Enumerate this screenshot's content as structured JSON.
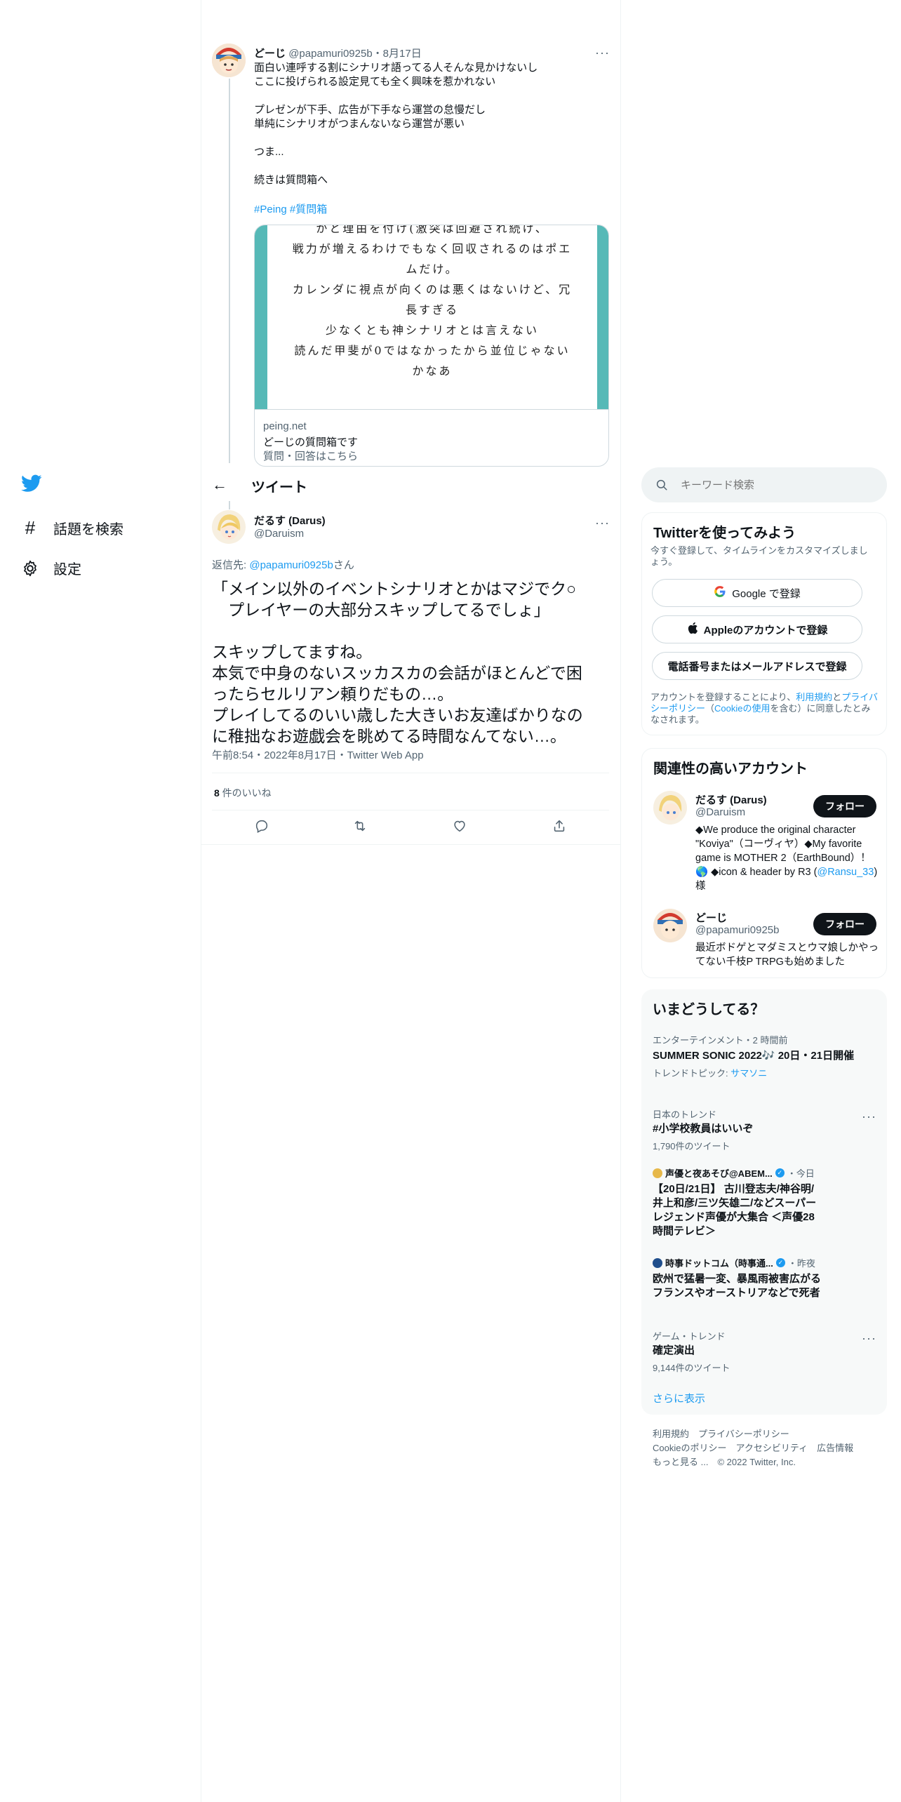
{
  "previous_tweet": {
    "author_name": "どーじ",
    "author_handle": "@papamuri0925b",
    "date": "・8月17日",
    "more": "···",
    "text": "面白い連呼する割にシナリオ語ってる人そんな見かけないし\nここに投げられる設定見ても全く興味を惹かれない\n\nプレゼンが下手、広告が下手なら運営の怠慢だし\n単純にシナリオがつまんないなら運営が悪い\n\nつま...\n\n続きは質問箱へ",
    "hashtags": "#Peing #質問箱",
    "card_image_text": "かと理由を付け(激突は回避され続け、\n戦力が増えるわけでもなく回収されるのはポエ\nムだけ。\nカレンダに視点が向くのは悪くはないけど、冗\n長すぎる\n少なくとも神シナリオとは言えない\n読んだ甲斐が0ではなかったから並位じゃない\nかなあ",
    "card_domain": "peing.net",
    "card_title": "どーじの質問箱です",
    "card_desc": "質問・回答はこちら"
  },
  "nav": {
    "explore_label": "話題を検索",
    "settings_label": "設定"
  },
  "header": {
    "back_arrow": "←",
    "title": "ツイート"
  },
  "main_tweet": {
    "author_name": "だるす (Darus)",
    "author_handle": "@Daruism",
    "more": "···",
    "reply_prefix": "返信先: ",
    "reply_handle": "@papamuri0925b",
    "reply_suffix": "さん",
    "text": "「メイン以外のイベントシナリオとかはマジでク○\n　プレイヤーの大部分スキップしてるでしょ」\n\nスキップしてますね。\n本気で中身のないスッカスカの会話がほとんどで困\nったらセルリアン頼りだもの…。\nプレイしてるのいい歳した大きいお友達ばかりなの\nに稚拙なお遊戯会を眺めてる時間なんてない…。",
    "timestamp": "午前8:54・2022年8月17日・Twitter Web App",
    "likes_count": "8",
    "likes_label": " 件のいいね"
  },
  "search": {
    "placeholder": "キーワード検索"
  },
  "signup": {
    "title": "Twitterを使ってみよう",
    "subtitle": "今すぐ登録して、タイムラインをカスタマイズしましょう。",
    "google_label": "Google で登録",
    "apple_label": "Appleのアカウントで登録",
    "phone_label": "電話番号またはメールアドレスで登録",
    "terms_prefix": "アカウントを登録することにより、",
    "terms_link": "利用規約",
    "terms_and": "と",
    "privacy_link": "プライバシーポリシー",
    "cookie_open": "（",
    "cookie_link": "Cookieの使用",
    "terms_suffix": "を含む）に同意したとみなされます。"
  },
  "related": {
    "title": "関連性の高いアカウント",
    "accounts": [
      {
        "name": "だるす (Darus)",
        "handle": "@Daruism",
        "follow_label": "フォロー",
        "bio": "◆We produce the original character \"Koviya\"（コーヴィヤ）◆My favorite game is MOTHER 2（EarthBound）！🌎 ◆icon & header by R3 (",
        "bio_link": "@Ransu_33",
        "bio_end": ") 様"
      },
      {
        "name": "どーじ",
        "handle": "@papamuri0925b",
        "follow_label": "フォロー",
        "bio": "最近ボドゲとマダミスとウマ娘しかやってない千枝P TRPGも始めました"
      }
    ]
  },
  "trends": {
    "title": "いまどうしてる？",
    "items": [
      {
        "meta": "エンターテインメント・2 時間前",
        "name": "SUMMER SONIC 2022🎶 20日・21日開催",
        "sub_prefix": "トレンドトピック: ",
        "sub_link": "サマソニ"
      },
      {
        "meta": "日本のトレンド",
        "name": "#小学校教員はいいぞ",
        "sub": "1,790件のツイート",
        "more": "···"
      },
      {
        "source": "声優と夜あそび@ABEM...",
        "time": "・今日",
        "name": "【20日/21日】 古川登志夫/神谷明/井上和彦/三ツ矢雄二/などスーパーレジェンド声優が大集合 ＜声優28時間テレビ＞"
      },
      {
        "source": "時事ドットコム（時事通...",
        "time": "・昨夜",
        "name": "欧州で猛暑一変、暴風雨被害広がる　フランスやオーストリアなどで死者"
      },
      {
        "meta": "ゲーム・トレンド",
        "name": "確定演出",
        "sub": "9,144件のツイート",
        "more": "···"
      }
    ],
    "show_more": "さらに表示"
  },
  "footer": {
    "line1": [
      "利用規約",
      "プライバシーポリシー"
    ],
    "line2": [
      "Cookieのポリシー",
      "アクセシビリティ",
      "広告情報"
    ],
    "more": "もっと見る ...",
    "copyright": "© 2022 Twitter, Inc."
  },
  "colors": {
    "accent": "#1d9bf0",
    "text": "#0f1419",
    "muted": "#536471",
    "border": "#eff3f4",
    "card_teal": "#56b9b7"
  }
}
